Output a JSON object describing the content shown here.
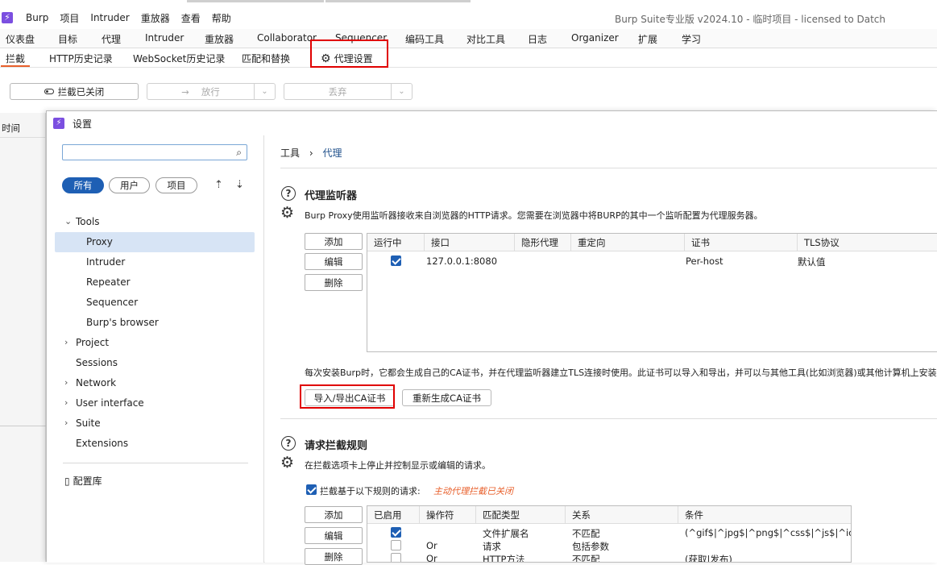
{
  "app": {
    "logo": "⚡",
    "window_title": "Burp Suite专业版  v2024.10 - 临时项目 - licensed to Datch"
  },
  "menu": [
    "Burp",
    "项目",
    "Intruder",
    "重放器",
    "查看",
    "帮助"
  ],
  "main_tabs": [
    "仪表盘",
    "目标",
    "代理",
    "Intruder",
    "重放器",
    "Collaborator",
    "Sequencer",
    "编码工具",
    "对比工具",
    "日志",
    "Organizer",
    "扩展",
    "学习"
  ],
  "proxy_tabs": [
    "拦截",
    "HTTP历史记录",
    "WebSocket历史记录",
    "匹配和替换",
    "代理设置"
  ],
  "toolbar": {
    "intercept_label": "拦截已关闭",
    "forward_label": "放行",
    "drop_label": "丢弃"
  },
  "left_col_header": "时间",
  "dialog": {
    "title": "设置",
    "search_placeholder": "",
    "filters": [
      "所有",
      "用户",
      "项目"
    ],
    "tree": {
      "tools": "Tools",
      "tools_children": [
        "Proxy",
        "Intruder",
        "Repeater",
        "Sequencer",
        "Burp's browser"
      ],
      "project": "Project",
      "sessions": "Sessions",
      "network": "Network",
      "user_interface": "User interface",
      "suite": "Suite",
      "extensions": "Extensions"
    },
    "config_library": "配置库",
    "breadcrumb": {
      "root": "工具",
      "sep": "›",
      "current": "代理"
    },
    "listeners": {
      "heading": "代理监听器",
      "description": "Burp Proxy使用监听器接收来自浏览器的HTTP请求。您需要在浏览器中将BURP的其中一个监听配置为代理服务器。",
      "buttons": [
        "添加",
        "编辑",
        "删除"
      ],
      "columns": [
        "运行中",
        "接口",
        "隐形代理",
        "重定向",
        "证书",
        "TLS协议"
      ],
      "rows": [
        {
          "running": true,
          "interface": "127.0.0.1:8080",
          "invisible": "",
          "redirect": "",
          "cert": "Per-host",
          "tls": "默认值"
        }
      ],
      "ca_text": "每次安装Burp时，它都会生成自己的CA证书，并在代理监听器建立TLS连接时使用。此证书可以导入和导出，并可以与其他工具(比如浏览器)或其他计算机上安装的",
      "import_export_btn": "导入/导出CA证书",
      "regenerate_btn": "重新生成CA证书"
    },
    "intercept": {
      "heading": "请求拦截规则",
      "description": "在拦截选项卡上停止并控制显示或编辑的请求。",
      "checkbox_label": "拦截基于以下规则的请求:",
      "checkbox_checked": true,
      "note": "主动代理拦截已关闭",
      "buttons": [
        "添加",
        "编辑",
        "删除"
      ],
      "columns": [
        "已启用",
        "操作符",
        "匹配类型",
        "关系",
        "条件"
      ],
      "rows": [
        {
          "enabled": true,
          "op": "",
          "type": "文件扩展名",
          "rel": "不匹配",
          "cond": "(^gif$|^jpg$|^png$|^css$|^js$|^ico..."
        },
        {
          "enabled": false,
          "op": "Or",
          "type": "请求",
          "rel": "包括参数",
          "cond": ""
        },
        {
          "enabled": false,
          "op": "Or",
          "type": "HTTP方法",
          "rel": "不匹配",
          "cond": "(获取|发布)"
        }
      ]
    }
  },
  "colors": {
    "accent": "#e8602c",
    "selected": "#1e5fb4",
    "highlight_box": "#e00000",
    "brand": "#7b4fe0"
  }
}
